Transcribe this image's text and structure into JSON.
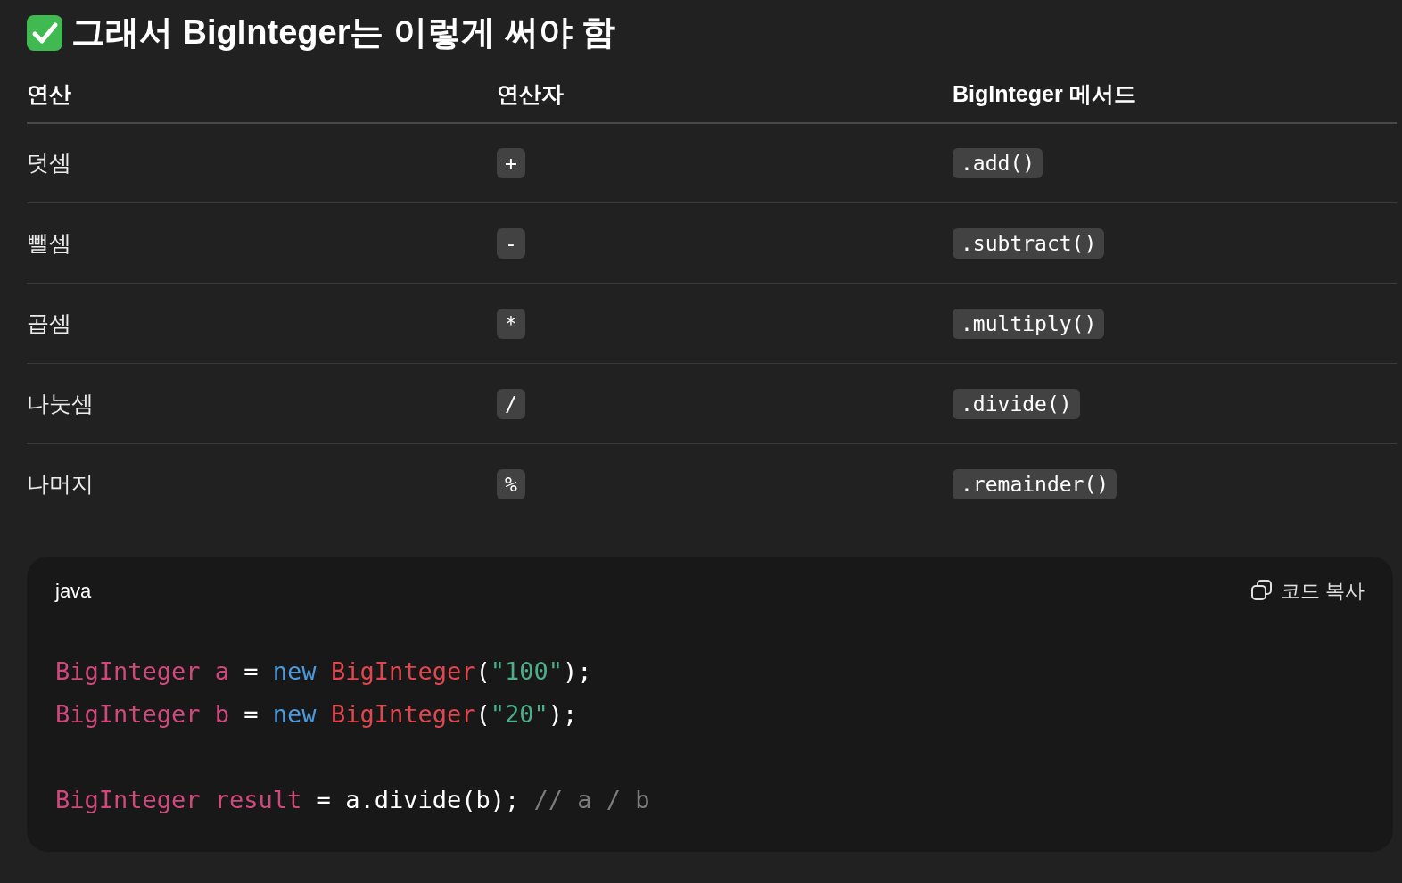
{
  "heading": {
    "text": "그래서 BigInteger는 이렇게 써야 함"
  },
  "table": {
    "columns": [
      "연산",
      "연산자",
      "BigInteger 메서드"
    ],
    "rows": [
      {
        "operation": "덧셈",
        "operator": "+",
        "method": ".add()"
      },
      {
        "operation": "뺄셈",
        "operator": "-",
        "method": ".subtract()"
      },
      {
        "operation": "곱셈",
        "operator": "*",
        "method": ".multiply()"
      },
      {
        "operation": "나눗셈",
        "operator": "/",
        "method": ".divide()"
      },
      {
        "operation": "나머지",
        "operator": "%",
        "method": ".remainder()"
      }
    ]
  },
  "code_block": {
    "language": "java",
    "copy_label": "코드 복사",
    "lines": [
      {
        "kind": "code",
        "tokens": [
          {
            "kind": "type",
            "text": "BigInteger"
          },
          {
            "kind": "var",
            "text": " a"
          },
          {
            "kind": "plain",
            "text": " = "
          },
          {
            "kind": "keyword",
            "text": "new"
          },
          {
            "kind": "ctor",
            "text": " BigInteger"
          },
          {
            "kind": "plain",
            "text": "("
          },
          {
            "kind": "string",
            "text": "\"100\""
          },
          {
            "kind": "plain",
            "text": ");"
          }
        ]
      },
      {
        "kind": "code",
        "tokens": [
          {
            "kind": "type",
            "text": "BigInteger"
          },
          {
            "kind": "var",
            "text": " b"
          },
          {
            "kind": "plain",
            "text": " = "
          },
          {
            "kind": "keyword",
            "text": "new"
          },
          {
            "kind": "ctor",
            "text": " BigInteger"
          },
          {
            "kind": "plain",
            "text": "("
          },
          {
            "kind": "string",
            "text": "\"20\""
          },
          {
            "kind": "plain",
            "text": ");"
          }
        ]
      },
      {
        "kind": "blank"
      },
      {
        "kind": "code",
        "tokens": [
          {
            "kind": "type",
            "text": "BigInteger"
          },
          {
            "kind": "var",
            "text": " result"
          },
          {
            "kind": "plain",
            "text": " = a.divide(b); "
          },
          {
            "kind": "comment",
            "text": "// a / b"
          }
        ]
      }
    ]
  }
}
